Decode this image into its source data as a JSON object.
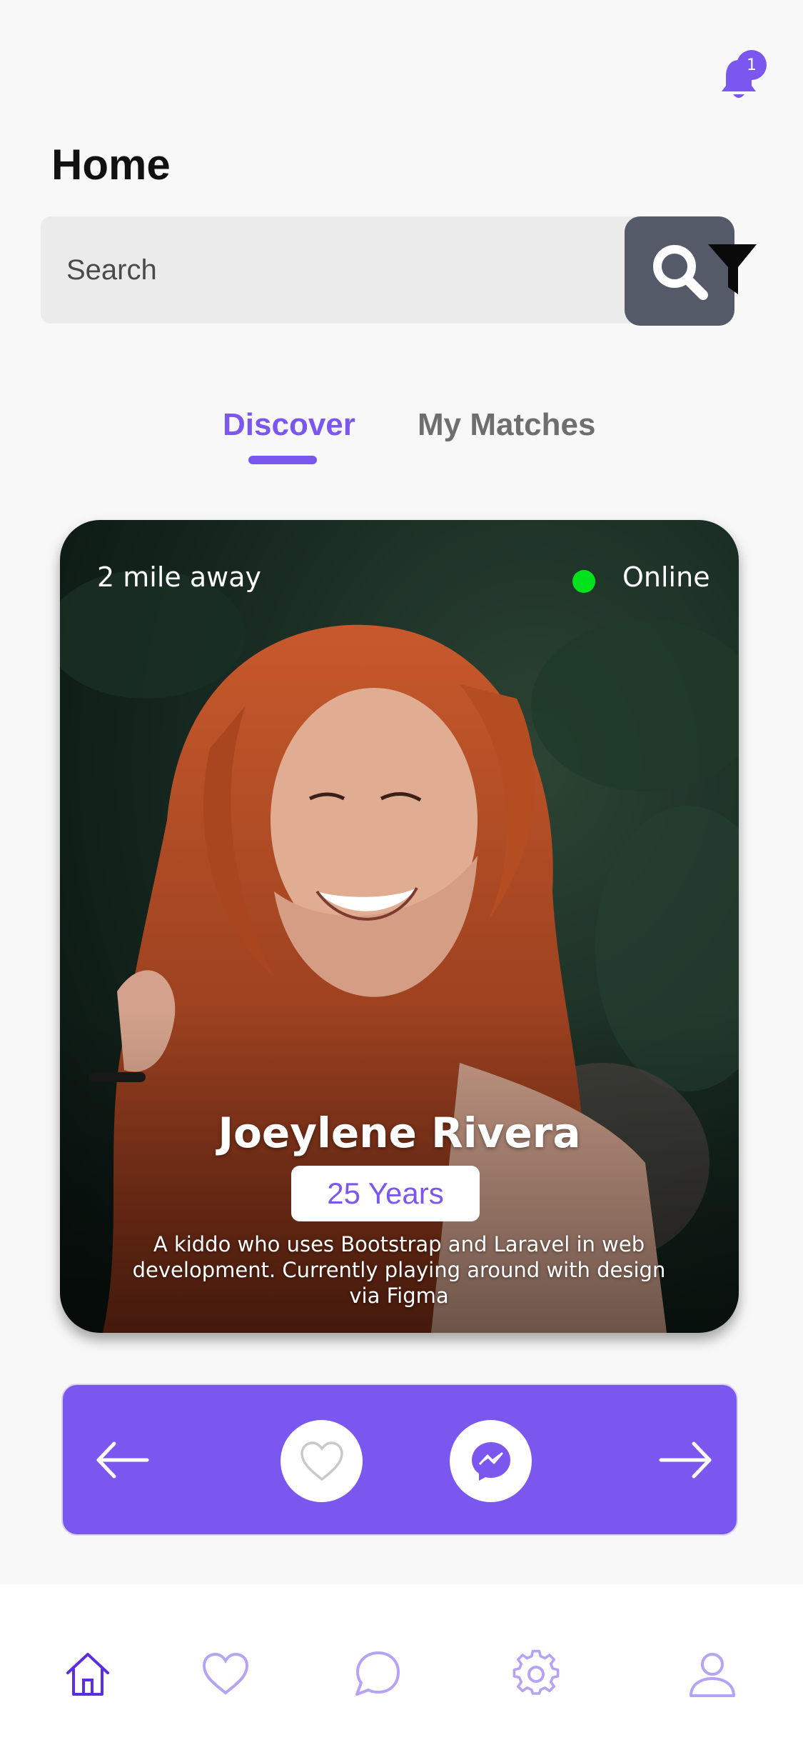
{
  "notifications": {
    "count": "1",
    "icon": "bell-icon"
  },
  "header": {
    "title": "Home"
  },
  "search": {
    "placeholder": "Search",
    "button_icon": "search-icon",
    "filter_icon": "filter-icon"
  },
  "tabs": [
    {
      "label": "Discover",
      "active": true
    },
    {
      "label": "My Matches",
      "active": false
    }
  ],
  "profile": {
    "distance": "2 mile away",
    "status": "Online",
    "name": "Joeylene Rivera",
    "age": "25 Years",
    "bio": "A kiddo who uses Bootstrap and Laravel in web development. Currently playing around with design via Figma"
  },
  "actions": {
    "icons": [
      "arrow-left-icon",
      "heart-icon",
      "messenger-icon",
      "arrow-right-icon"
    ]
  },
  "nav": {
    "icons": [
      "home-icon",
      "heart-icon",
      "chat-icon",
      "gear-icon",
      "user-icon"
    ],
    "active": "home"
  },
  "colors": {
    "accent": "#7b57ef",
    "search_button": "#555a69",
    "online": "#00e21b",
    "nav_inactive": "#b6a3f4"
  }
}
